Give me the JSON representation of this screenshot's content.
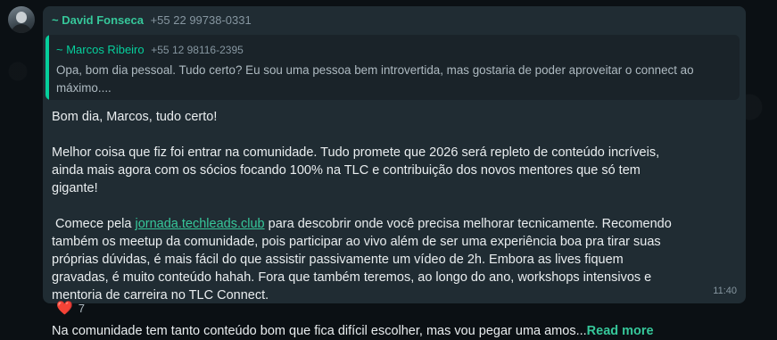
{
  "message": {
    "sender_name": "~ David Fonseca",
    "sender_phone": "+55 22 99738-0331",
    "quote": {
      "sender_name": "~ Marcos Ribeiro",
      "sender_phone": "+55 12 98116-2395",
      "text": "Opa, bom dia pessoal. Tudo certo? Eu sou uma pessoa bem introvertida, mas gostaria de poder aproveitar o connect ao máximo...."
    },
    "greeting": "Bom dia, Marcos, tudo certo!",
    "paragraph_1": "Melhor coisa que fiz foi entrar na comunidade. Tudo promete que 2026 será repleto de conteúdo incríveis, ainda mais agora com os sócios focando 100% na TLC e contribuição dos novos mentores que só tem gigante!",
    "paragraph_2_prefix": " Comece pela ",
    "paragraph_2_link": "jornada.techleads.club",
    "paragraph_2_suffix": " para descobrir onde você precisa melhorar tecnicamente. Recomendo também os meetup da comunidade, pois participar ao vivo além de ser uma experiência boa pra tirar suas próprias dúvidas, é mais fácil do que assistir passivamente um vídeo de 2h. Embora as lives fiquem gravadas, é muito conteúdo hahah. Fora que também teremos, ao longo do ano, workshops intensivos e mentoria de carreira no TLC Connect.",
    "paragraph_3": "Na comunidade tem tanto conteúdo bom que fica difícil escolher, mas vou pegar uma amos...",
    "read_more": "Read more",
    "time": "11:40"
  },
  "reaction": {
    "icon": "heart-icon",
    "emoji": "❤️",
    "count": "7"
  }
}
